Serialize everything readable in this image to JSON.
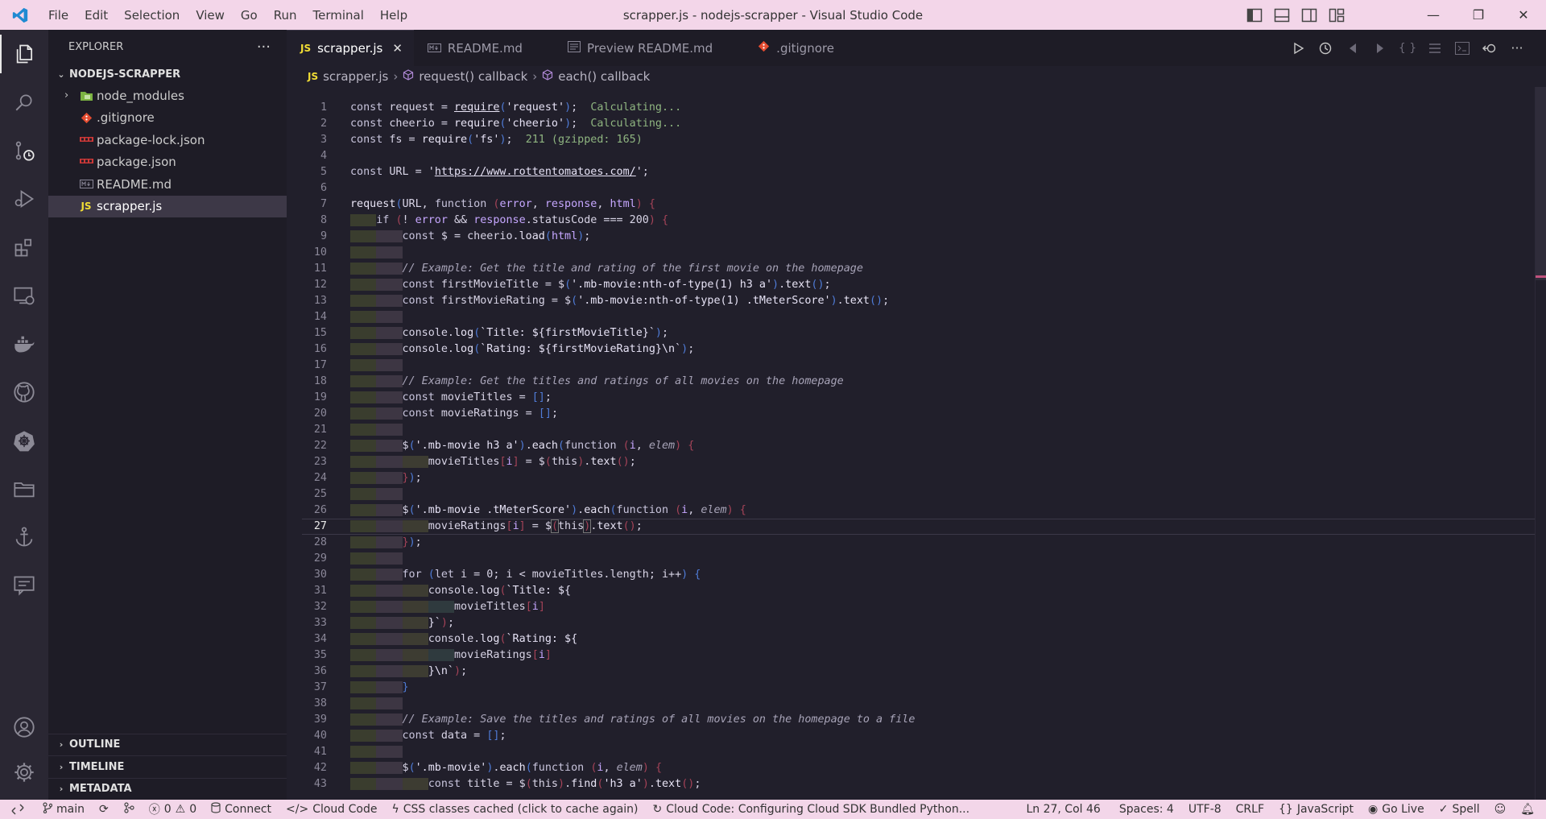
{
  "window": {
    "title": "scrapper.js - nodejs-scrapper - Visual Studio Code",
    "menu": [
      "File",
      "Edit",
      "Selection",
      "View",
      "Go",
      "Run",
      "Terminal",
      "Help"
    ]
  },
  "activity_bar": {
    "items": [
      "explorer-icon",
      "search-icon",
      "source-control-icon",
      "run-debug-icon",
      "extensions-icon",
      "remote-explorer-icon",
      "docker-icon",
      "github-icon",
      "kubernetes-icon",
      "folder-icon",
      "anchor-icon",
      "comments-icon"
    ],
    "bottom": [
      "account-icon",
      "settings-gear-icon"
    ]
  },
  "explorer": {
    "title": "EXPLORER",
    "more": "···",
    "project": "NODEJS-SCRAPPER",
    "files": [
      {
        "name": "node_modules",
        "type": "folder"
      },
      {
        "name": ".gitignore",
        "type": "git"
      },
      {
        "name": "package-lock.json",
        "type": "npm"
      },
      {
        "name": "package.json",
        "type": "npm"
      },
      {
        "name": "README.md",
        "type": "md"
      },
      {
        "name": "scrapper.js",
        "type": "js",
        "icon_label": "JS"
      }
    ],
    "panels": [
      "OUTLINE",
      "TIMELINE",
      "METADATA"
    ]
  },
  "tabs": [
    {
      "label": "scrapper.js",
      "prefix": "JS",
      "active": true,
      "close": "✕"
    },
    {
      "label": "README.md",
      "prefix": "M↓",
      "active": false
    },
    {
      "label": "Preview README.md",
      "prefix": "",
      "active": false
    },
    {
      "label": ".gitignore",
      "prefix": "",
      "active": false
    }
  ],
  "breadcrumb": {
    "file": "scrapper.js",
    "file_prefix": "JS",
    "items": [
      "request() callback",
      "each() callback"
    ]
  },
  "editor": {
    "current_line": 27,
    "line_count": 43
  },
  "statusbar": {
    "branch": "main",
    "errors": "0",
    "warnings": "0",
    "connect": "Connect",
    "cloud_code": "Cloud Code",
    "css_cache": "CSS classes cached (click to cache again)",
    "cloud_status": "Cloud Code: Configuring Cloud SDK Bundled Python...",
    "position": "Ln 27, Col 46",
    "spaces": "Spaces: 4",
    "encoding": "UTF-8",
    "eol": "CRLF",
    "language": "JavaScript",
    "go_live": "Go Live",
    "spell": "Spell"
  },
  "colors": {
    "titlebar": "#f3d6e9",
    "statusbar": "#f3d6e9",
    "editor_bg": "#211f2b",
    "sidebar_bg": "#1e1c26"
  }
}
